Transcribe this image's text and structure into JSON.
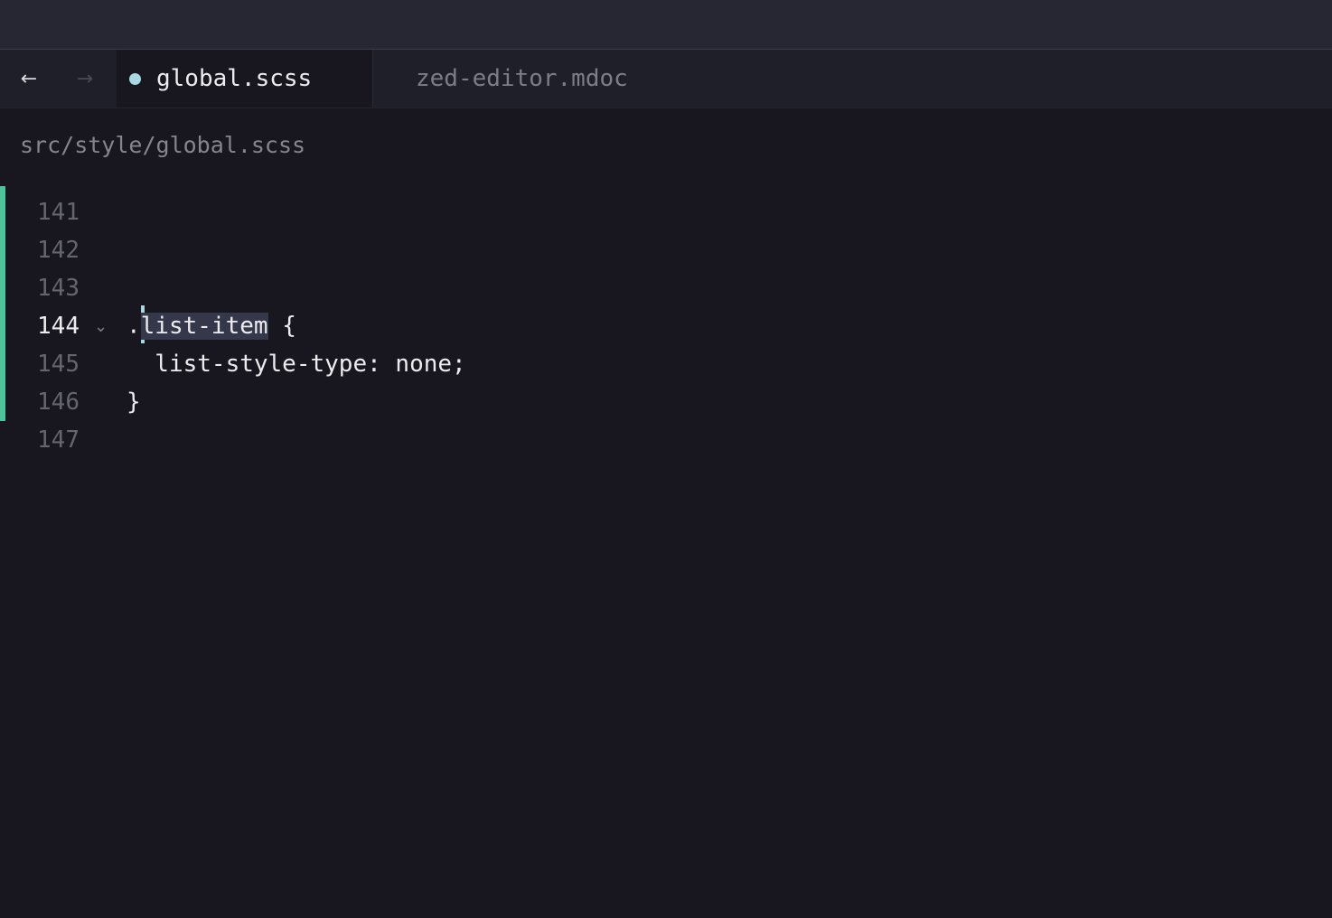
{
  "tabs": {
    "back_icon": "←",
    "forward_icon": "→",
    "active": "global.scss",
    "inactive": "zed-editor.mdoc"
  },
  "breadcrumb": "src/style/global.scss",
  "editor": {
    "lines": [
      {
        "num": "141",
        "code": ""
      },
      {
        "num": "142",
        "code": ""
      },
      {
        "num": "143",
        "code": ""
      },
      {
        "num": "144",
        "prefix": ".",
        "selected": "list-item",
        "suffix": " {"
      },
      {
        "num": "145",
        "code": "  list-style-type: none;"
      },
      {
        "num": "146",
        "code": "}"
      },
      {
        "num": "147",
        "code": ""
      }
    ],
    "fold_icon": "⌄"
  },
  "colors": {
    "background": "#18171f",
    "accent": "#a9d8e2",
    "git_marker": "#4cc39b"
  }
}
